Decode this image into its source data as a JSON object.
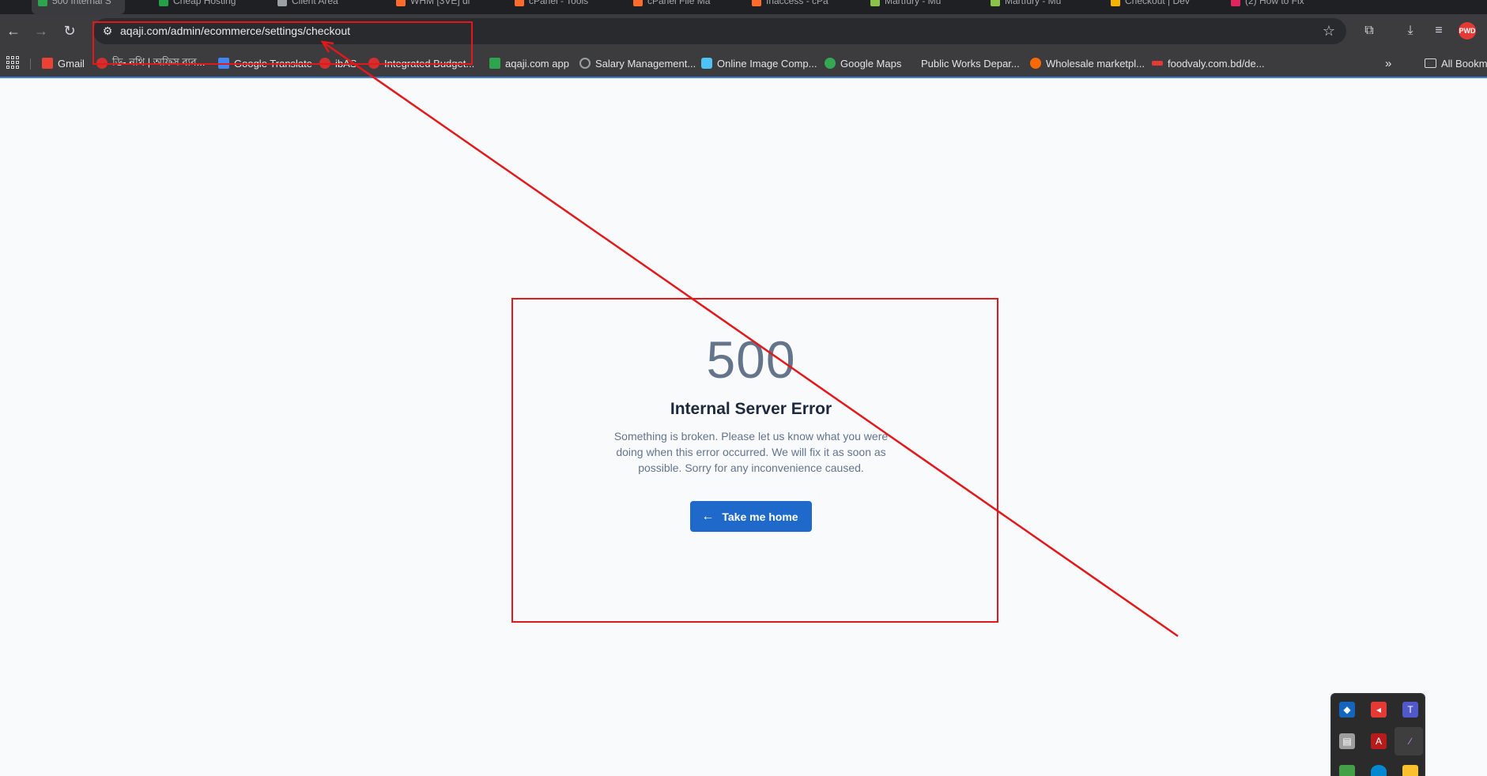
{
  "browser": {
    "tabs": [
      {
        "title": "500 Internal S",
        "color": "#2da44e",
        "active": true
      },
      {
        "title": "Cheap Hosting",
        "color": "#24a148",
        "active": false
      },
      {
        "title": "Client Area",
        "color": "#9aa0a6",
        "active": false
      },
      {
        "title": "WHM [3VE] di",
        "color": "#ff6c2c",
        "active": false
      },
      {
        "title": "cPanel - Tools",
        "color": "#ff6c2c",
        "active": false
      },
      {
        "title": "cPanel File Ma",
        "color": "#ff6c2c",
        "active": false
      },
      {
        "title": "Inaccess - cPa",
        "color": "#ff6c2c",
        "active": false
      },
      {
        "title": "Martfury - Mu",
        "color": "#8bc34a",
        "active": false
      },
      {
        "title": "Martfury - Mu",
        "color": "#8bc34a",
        "active": false
      },
      {
        "title": "Checkout | Dev",
        "color": "#f4b400",
        "active": false
      },
      {
        "title": "(2) How to Fix",
        "color": "#e0245e",
        "active": false
      }
    ],
    "url": "aqaji.com/admin/ecommerce/settings/checkout",
    "profile_initials": "PWD",
    "bookmarks": [
      {
        "label": "Gmail",
        "icon": "gmail-icon",
        "color": "#ea4335"
      },
      {
        "label": "ডি- নথি | অফিস ব্যব...",
        "icon": "govt-seal-icon",
        "color": "#d32f2f"
      },
      {
        "label": "Google Translate",
        "icon": "translate-icon",
        "color": "#4285f4"
      },
      {
        "label": "ibAS",
        "icon": "govt-seal-icon",
        "color": "#d32f2f"
      },
      {
        "label": "Integrated Budget...",
        "icon": "govt-seal-icon",
        "color": "#d32f2f"
      },
      {
        "label": "aqaji.com app",
        "icon": "aqaji-icon",
        "color": "#2ea44f"
      },
      {
        "label": "Salary Management...",
        "icon": "globe-icon",
        "color": "#9aa0a6"
      },
      {
        "label": "Online Image Comp...",
        "icon": "image-compress-icon",
        "color": "#4fc3f7"
      },
      {
        "label": "Google Maps",
        "icon": "maps-icon",
        "color": "#34a853"
      },
      {
        "label": "Public Works Depar...",
        "icon": "pwd-icon",
        "color": "#3c3c3f"
      },
      {
        "label": "Wholesale marketpl...",
        "icon": "alibaba-icon",
        "color": "#ff6a00"
      },
      {
        "label": "foodvaly.com.bd/de...",
        "icon": "foodvaly-icon",
        "color": "#e53935"
      }
    ],
    "all_bookmarks_label": "All Bookmarks"
  },
  "error": {
    "code": "500",
    "title": "Internal Server Error",
    "description": "Something is broken. Please let us know what you were doing when this error occurred. We will fix it as soon as possible. Sorry for any inconvenience caused.",
    "button_label": "Take me home"
  },
  "colors": {
    "annotation": "#e3181b",
    "button": "#1e69c9",
    "page_background": "#f8fafc"
  }
}
